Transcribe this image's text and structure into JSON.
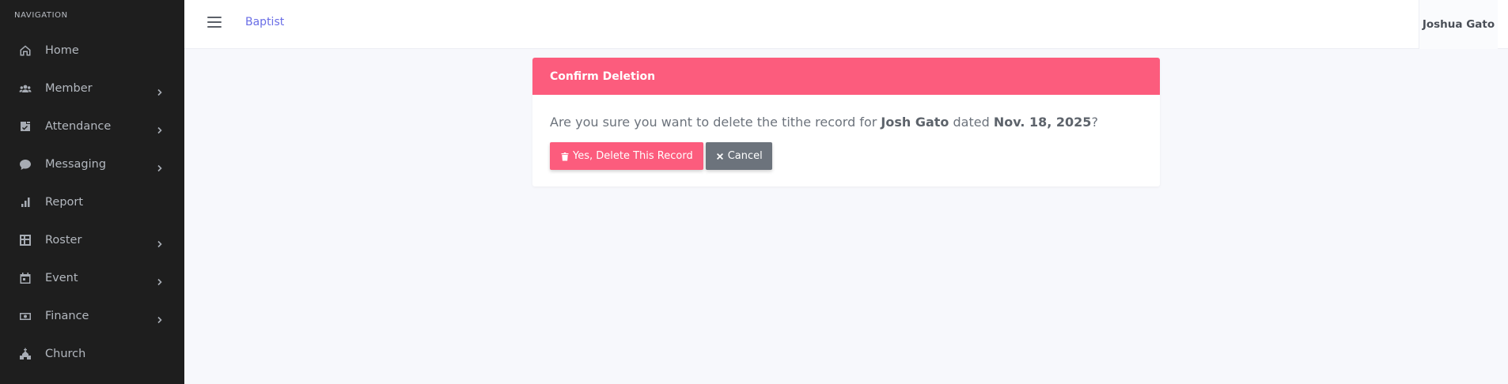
{
  "sidebar": {
    "heading": "NAVIGATION",
    "items": [
      {
        "label": "Home",
        "icon": "home-icon",
        "has_submenu": false
      },
      {
        "label": "Member",
        "icon": "users-icon",
        "has_submenu": true
      },
      {
        "label": "Attendance",
        "icon": "clipboard-icon",
        "has_submenu": true
      },
      {
        "label": "Messaging",
        "icon": "chat-icon",
        "has_submenu": true
      },
      {
        "label": "Report",
        "icon": "bar-chart-icon",
        "has_submenu": false
      },
      {
        "label": "Roster",
        "icon": "grid-icon",
        "has_submenu": true
      },
      {
        "label": "Event",
        "icon": "calendar-icon",
        "has_submenu": true
      },
      {
        "label": "Finance",
        "icon": "money-icon",
        "has_submenu": true
      },
      {
        "label": "Church",
        "icon": "church-icon",
        "has_submenu": false
      }
    ]
  },
  "header": {
    "brand": "Baptist",
    "user_name": "Joshua Gato"
  },
  "dialog": {
    "title": "Confirm Deletion",
    "message_prefix": "Are you sure you want to delete the tithe record for ",
    "member_name": "Josh Gato",
    "message_middle": " dated ",
    "record_date": "Nov. 18, 2025",
    "message_suffix": "?",
    "confirm_label": "Yes, Delete This Record",
    "cancel_label": "Cancel"
  },
  "colors": {
    "sidebar_bg": "#1e1e1e",
    "accent_danger": "#fc5c7d",
    "secondary": "#6c737c",
    "brand_link": "#6a6ee6",
    "page_bg": "#f7f8fc"
  }
}
